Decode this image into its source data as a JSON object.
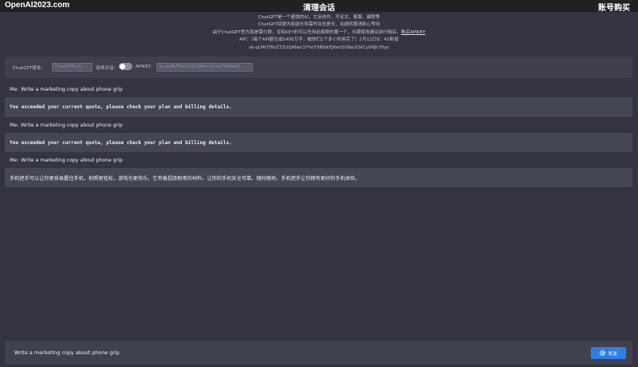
{
  "header": {
    "brand": "OpenAI2023.com",
    "clear_label": "清理会话",
    "account_label": "账号购买"
  },
  "notice": {
    "line1": "ChatGPT是一个超强的AI，它会创作，写论文，客服，编程等",
    "line2": "ChatGPT回复内容越长所需时间也更长，如遇转圈请耐心等待",
    "line3": "由于ChatGPT官方现是需付费，没有KEY的可以先用前面费的第一个，长期使用建议自行购买，",
    "buy_link": "购买APIKEY",
    "line4": "API：（每个API额生成5400万字，被你们1个多小时用完了）2月12日9：45新增",
    "line5": "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"
  },
  "settings": {
    "version_label": "ChatGPT版本:",
    "version_value": "ChatGPT-v3",
    "continuous_label": "连续对话:",
    "continuous_on": false,
    "apikey_label": "APIKEY:",
    "apikey_value": "sk-qLMUT8vZ7ZUQAfwn1YhoT3BlbkFJ"
  },
  "messages": [
    {
      "role": "user",
      "speaker": "Me:",
      "text": "Write a marketing copy about phone grip"
    },
    {
      "role": "bot",
      "text": "You exceeded your current quota, please check your plan and billing details."
    },
    {
      "role": "user",
      "speaker": "Me:",
      "text": "Write a marketing copy about phone grip"
    },
    {
      "role": "bot",
      "text": "You exceeded your current quota, please check your plan and billing details."
    },
    {
      "role": "user",
      "speaker": "Me:",
      "text": "Write a marketing copy about phone grip"
    },
    {
      "role": "bot",
      "text": "手机把手可以让你更容易握住手机，拍照更轻松，游戏也更快乐。它有着超级耐用的材料，让你的手机安全可靠。随时随地，手机把手让你拥有更好的手机体验。"
    }
  ],
  "input": {
    "value": "Write a marketing copy about phone grip"
  },
  "send_button": {
    "label": "发送",
    "icon": "send-icon"
  },
  "colors": {
    "background": "#343541",
    "header": "#202123",
    "bot_row": "#444654",
    "send_button": "#2f7de1"
  }
}
